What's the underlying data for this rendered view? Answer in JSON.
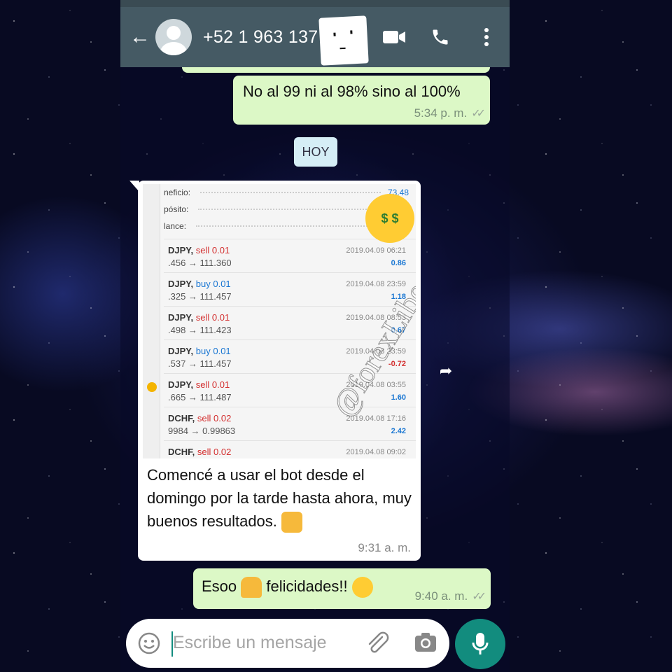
{
  "header": {
    "contact_name": "+52 1 963 137",
    "back_icon": "arrow-left-icon",
    "actions": [
      "video-call-icon",
      "phone-icon",
      "more-vert-icon"
    ]
  },
  "messages": [
    {
      "direction": "outgoing",
      "text": "No al 99 ni al 98% sino al 100%",
      "time": "5:34 p. m."
    },
    {
      "direction": "incoming",
      "text": "Comencé a usar el bot desde el domingo por la tarde hasta ahora, muy buenos resultados.",
      "time": "9:31 a. m."
    },
    {
      "direction": "outgoing",
      "text_1": "Esoo",
      "text_2": "felicidades!!",
      "time": "9:40 a. m."
    }
  ],
  "date_divider": "HOY",
  "screenshot": {
    "watermark": "@forexLiberty",
    "summary": [
      {
        "label": "neficio:",
        "value": "73.48"
      },
      {
        "label": "pósito:",
        "value": ""
      },
      {
        "label": "lance:",
        "value": ""
      }
    ],
    "trades": [
      {
        "symbol": "DJPY,",
        "side": "sell",
        "lot": "0.01",
        "prices": ".456 → 111.360",
        "time": "2019.04.09 06:21",
        "profit": "0.86"
      },
      {
        "symbol": "DJPY,",
        "side": "buy",
        "lot": "0.01",
        "prices": ".325 → 111.457",
        "time": "2019.04.08 23:59",
        "profit": "1.18"
      },
      {
        "symbol": "DJPY,",
        "side": "sell",
        "lot": "0.01",
        "prices": ".498 → 111.423",
        "time": "2019.04.08 08:53",
        "profit": "0.67"
      },
      {
        "symbol": "DJPY,",
        "side": "buy",
        "lot": "0.01",
        "prices": ".537 → 111.457",
        "time": "2019.04.08 23:59",
        "profit": "-0.72"
      },
      {
        "symbol": "DJPY,",
        "side": "sell",
        "lot": "0.01",
        "prices": ".665 → 111.487",
        "time": "2019.04.08 03:55",
        "profit": "1.60"
      },
      {
        "symbol": "DCHF,",
        "side": "sell",
        "lot": "0.02",
        "prices": "9984 → 0.99863",
        "time": "2019.04.08 17:16",
        "profit": "2.42"
      },
      {
        "symbol": "DCHF,",
        "side": "sell",
        "lot": "0.02",
        "prices": "",
        "time": "2019.04.08 09:02",
        "profit": ""
      }
    ]
  },
  "composer": {
    "placeholder": "Escribe un mensaje",
    "icons": [
      "emoji-icon",
      "attach-icon",
      "camera-icon",
      "mic-icon"
    ]
  },
  "colors": {
    "header": "#455a64",
    "outgoing_bubble": "#dcf8c6",
    "incoming_bubble": "#ffffff",
    "accent": "#128c7e",
    "sell": "#d32f2f",
    "buy": "#1976d2"
  }
}
